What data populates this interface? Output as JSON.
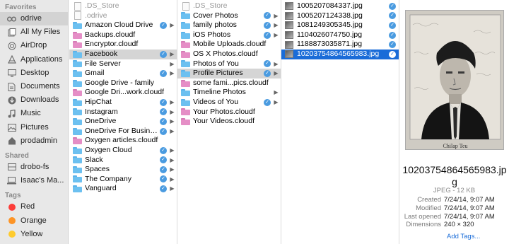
{
  "sidebar": {
    "favorites_label": "Favorites",
    "favorites": [
      {
        "label": "odrive",
        "icon": "odrive-icon",
        "selected": true
      },
      {
        "label": "All My Files",
        "icon": "all-files-icon"
      },
      {
        "label": "AirDrop",
        "icon": "airdrop-icon"
      },
      {
        "label": "Applications",
        "icon": "applications-icon"
      },
      {
        "label": "Desktop",
        "icon": "desktop-icon"
      },
      {
        "label": "Documents",
        "icon": "documents-icon"
      },
      {
        "label": "Downloads",
        "icon": "downloads-icon"
      },
      {
        "label": "Music",
        "icon": "music-icon"
      },
      {
        "label": "Pictures",
        "icon": "pictures-icon"
      },
      {
        "label": "prodadmin",
        "icon": "home-icon"
      }
    ],
    "shared_label": "Shared",
    "shared": [
      {
        "label": "drobo-fs",
        "icon": "server-icon"
      },
      {
        "label": "Isaac's Ma...",
        "icon": "computer-icon"
      }
    ],
    "tags_label": "Tags",
    "tags": [
      {
        "label": "Red",
        "color": "#fc3d39"
      },
      {
        "label": "Orange",
        "color": "#fd9426"
      },
      {
        "label": "Yellow",
        "color": "#fecb2e"
      }
    ]
  },
  "column1": {
    "items": [
      {
        "name": ".DS_Store",
        "kind": "doc",
        "dim": true,
        "sync": false,
        "arrow": false
      },
      {
        "name": ".odrive",
        "kind": "doc",
        "dim": true,
        "sync": false,
        "arrow": false
      },
      {
        "name": "Amazon Cloud Drive",
        "kind": "folder",
        "sync": true,
        "arrow": true
      },
      {
        "name": "Backups.cloudf",
        "kind": "folder-pink",
        "sync": false,
        "arrow": false
      },
      {
        "name": "Encryptor.cloudf",
        "kind": "folder-pink",
        "sync": false,
        "arrow": false
      },
      {
        "name": "Facebook",
        "kind": "folder",
        "sync": true,
        "arrow": true,
        "selected": true
      },
      {
        "name": "File Server",
        "kind": "folder",
        "sync": false,
        "arrow": true
      },
      {
        "name": "Gmail",
        "kind": "folder",
        "sync": true,
        "arrow": true
      },
      {
        "name": "Google Drive - family",
        "kind": "folder",
        "sync": false,
        "arrow": false
      },
      {
        "name": "Google Dri...work.cloudf",
        "kind": "folder-pink",
        "sync": false,
        "arrow": false
      },
      {
        "name": "HipChat",
        "kind": "folder",
        "sync": true,
        "arrow": true
      },
      {
        "name": "Instagram",
        "kind": "folder",
        "sync": true,
        "arrow": true
      },
      {
        "name": "OneDrive",
        "kind": "folder",
        "sync": true,
        "arrow": true
      },
      {
        "name": "OneDrive For Business",
        "kind": "folder",
        "sync": true,
        "arrow": true
      },
      {
        "name": "Oxygen articles.cloudf",
        "kind": "folder-pink",
        "sync": false,
        "arrow": false
      },
      {
        "name": "Oxygen Cloud",
        "kind": "folder",
        "sync": true,
        "arrow": true
      },
      {
        "name": "Slack",
        "kind": "folder",
        "sync": true,
        "arrow": true
      },
      {
        "name": "Spaces",
        "kind": "folder",
        "sync": true,
        "arrow": true
      },
      {
        "name": "The Company",
        "kind": "folder",
        "sync": true,
        "arrow": true
      },
      {
        "name": "Vanguard",
        "kind": "folder",
        "sync": true,
        "arrow": true
      }
    ]
  },
  "column2": {
    "items": [
      {
        "name": ".DS_Store",
        "kind": "doc",
        "dim": true,
        "sync": false,
        "arrow": false
      },
      {
        "name": "Cover Photos",
        "kind": "folder",
        "sync": true,
        "arrow": true
      },
      {
        "name": "family photos",
        "kind": "folder",
        "sync": true,
        "arrow": true
      },
      {
        "name": "iOS Photos",
        "kind": "folder",
        "sync": true,
        "arrow": true
      },
      {
        "name": "Mobile Uploads.cloudf",
        "kind": "folder-pink",
        "sync": false,
        "arrow": false
      },
      {
        "name": "OS X Photos.cloudf",
        "kind": "folder-pink",
        "sync": false,
        "arrow": false
      },
      {
        "name": "Photos of You",
        "kind": "folder",
        "sync": true,
        "arrow": true
      },
      {
        "name": "Profile Pictures",
        "kind": "folder",
        "sync": true,
        "arrow": true,
        "selected": true
      },
      {
        "name": "some fami...pics.cloudf",
        "kind": "folder-pink",
        "sync": false,
        "arrow": false
      },
      {
        "name": "Timeline Photos",
        "kind": "folder",
        "sync": false,
        "arrow": true
      },
      {
        "name": "Videos of You",
        "kind": "folder",
        "sync": true,
        "arrow": true
      },
      {
        "name": "Your Photos.cloudf",
        "kind": "folder-pink",
        "sync": false,
        "arrow": false
      },
      {
        "name": "Your Videos.cloudf",
        "kind": "folder-pink",
        "sync": false,
        "arrow": false
      }
    ]
  },
  "column3": {
    "items": [
      {
        "name": "1005207084337.jpg",
        "kind": "image",
        "sync": true
      },
      {
        "name": "1005207124338.jpg",
        "kind": "image",
        "sync": true
      },
      {
        "name": "1081249305345.jpg",
        "kind": "image",
        "sync": true
      },
      {
        "name": "1104026074750.jpg",
        "kind": "image",
        "sync": true
      },
      {
        "name": "1188873035871.jpg",
        "kind": "image",
        "sync": true
      },
      {
        "name": "10203754864565983.jpg",
        "kind": "image",
        "sync": true,
        "highlighted": true
      }
    ]
  },
  "preview": {
    "photo_caption": "Chilap Teu",
    "filename": "10203754864565983.jpg",
    "kind_size": "JPEG - 12 KB",
    "meta": [
      {
        "key": "Created",
        "value": "7/24/14, 9:07 AM"
      },
      {
        "key": "Modified",
        "value": "7/24/14, 9:07 AM"
      },
      {
        "key": "Last opened",
        "value": "7/24/14, 9:07 AM"
      },
      {
        "key": "Dimensions",
        "value": "240 × 320"
      }
    ],
    "add_tags": "Add Tags..."
  },
  "colors": {
    "selection_blue": "#1a6cd8",
    "sync_badge": "#4a9be0",
    "folder_blue": "#6cc0f0",
    "cloud_folder_pink": "#e58ec6"
  }
}
